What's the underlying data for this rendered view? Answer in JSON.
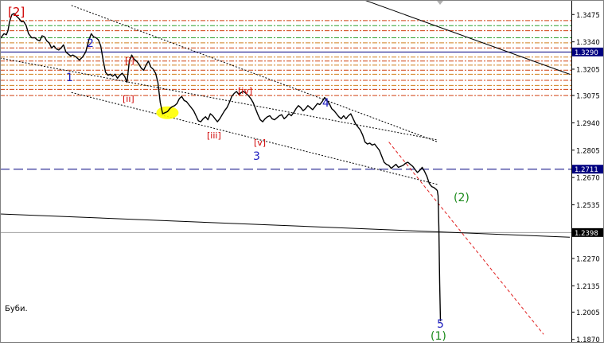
{
  "chart_data": {
    "type": "line",
    "symbol_label": "Буби.",
    "corner_label": "[2]",
    "y_axis": {
      "ticks": [
        1.3475,
        1.334,
        1.3205,
        1.3075,
        1.294,
        1.2805,
        1.267,
        1.2535,
        1.2405,
        1.227,
        1.2135,
        1.2005,
        1.187
      ],
      "range": [
        1.1865,
        1.3535
      ],
      "price_tags": [
        {
          "value": 1.329,
          "text": "1.3290",
          "style": "blue"
        },
        {
          "value": 1.2711,
          "text": "1.2711",
          "style": "blue"
        },
        {
          "value": 1.2398,
          "text": "1.2398",
          "style": "black"
        }
      ]
    },
    "wave_labels": [
      {
        "text": "[2]",
        "color": "#d00000"
      },
      {
        "text": "1",
        "color": "#2020c0"
      },
      {
        "text": "2",
        "color": "#2020c0"
      },
      {
        "text": "[i]",
        "color": "#d00000"
      },
      {
        "text": "[ii]",
        "color": "#d00000"
      },
      {
        "text": "[iii]",
        "color": "#d00000"
      },
      {
        "text": "[iv]",
        "color": "#d00000"
      },
      {
        "text": "[v]",
        "color": "#d00000"
      },
      {
        "text": "3",
        "color": "#2020c0"
      },
      {
        "text": "4",
        "color": "#2020c0"
      },
      {
        "text": "(2)",
        "color": "#1a8a1a"
      },
      {
        "text": "5",
        "color": "#2020c0"
      },
      {
        "text": "(1)",
        "color": "#1a8a1a"
      }
    ],
    "horizontal_levels": [
      {
        "value": 1.329,
        "style": "solid",
        "color": "#000080"
      },
      {
        "value": 1.2711,
        "style": "dashed",
        "color": "#000080"
      },
      {
        "value": 1.2398,
        "style": "solid",
        "color": "#a0a0a0"
      }
    ],
    "resistance_band_levels": [
      {
        "value": 1.3445,
        "color": "#d04010"
      },
      {
        "value": 1.342,
        "color": "#30a030"
      },
      {
        "value": 1.3395,
        "color": "#d04010"
      },
      {
        "value": 1.336,
        "color": "#30a030"
      },
      {
        "value": 1.3335,
        "color": "#d08020"
      },
      {
        "value": 1.331,
        "color": "#d04010"
      },
      {
        "value": 1.3265,
        "color": "#d08020"
      },
      {
        "value": 1.3245,
        "color": "#d04010"
      },
      {
        "value": 1.3225,
        "color": "#d08020"
      },
      {
        "value": 1.32,
        "color": "#d04010"
      },
      {
        "value": 1.318,
        "color": "#d08020"
      },
      {
        "value": 1.315,
        "color": "#d04010"
      },
      {
        "value": 1.3125,
        "color": "#d08020"
      },
      {
        "value": 1.3105,
        "color": "#d04010"
      },
      {
        "value": 1.3075,
        "color": "#d04010"
      }
    ],
    "price_series": {
      "name": "",
      "x": [
        0,
        2,
        5,
        8,
        10,
        12,
        15,
        18,
        20,
        24,
        27,
        30,
        33,
        36,
        40,
        44,
        47,
        50,
        53,
        56,
        59,
        62,
        65,
        68,
        71,
        74,
        77,
        80,
        83,
        86,
        89,
        92,
        96,
        100,
        104,
        108,
        112,
        115,
        118,
        121,
        124,
        127,
        130,
        133,
        136,
        139,
        142,
        145,
        148,
        151,
        154,
        157,
        160,
        163,
        166,
        169,
        172,
        175,
        178,
        181,
        184,
        187,
        190,
        193,
        196,
        199,
        202,
        205,
        208,
        211,
        214,
        217,
        220,
        223,
        226,
        229,
        232,
        235,
        238,
        241,
        244,
        247,
        250,
        253,
        256,
        259,
        262,
        265,
        268,
        271,
        274,
        277,
        280,
        283,
        286,
        289,
        292,
        295,
        298,
        301,
        304,
        307,
        310,
        313,
        316,
        319,
        322,
        325,
        328,
        331,
        334,
        337,
        340,
        343,
        346,
        349,
        352,
        355,
        358,
        361,
        364,
        367,
        370,
        373,
        376,
        379,
        382,
        385,
        388,
        391,
        394,
        397,
        400,
        403,
        406,
        409,
        412,
        415,
        418,
        421,
        424,
        427,
        430,
        433,
        436,
        439,
        442,
        445,
        448,
        451,
        454,
        457,
        460,
        463,
        466,
        469,
        472,
        475,
        478,
        481,
        484,
        487,
        490,
        493,
        496,
        499,
        502,
        505,
        508,
        511,
        514,
        517,
        520,
        523,
        526,
        529,
        532,
        535,
        538,
        541,
        544,
        547,
        550,
        551,
        552,
        553,
        554,
        555
      ],
      "y": [
        1.3355,
        1.3365,
        1.338,
        1.3375,
        1.3395,
        1.344,
        1.3475,
        1.348,
        1.347,
        1.3455,
        1.344,
        1.344,
        1.342,
        1.338,
        1.336,
        1.336,
        1.335,
        1.3345,
        1.337,
        1.3365,
        1.3345,
        1.3335,
        1.331,
        1.332,
        1.3305,
        1.33,
        1.331,
        1.3325,
        1.329,
        1.328,
        1.327,
        1.3275,
        1.3265,
        1.325,
        1.3265,
        1.329,
        1.335,
        1.338,
        1.3365,
        1.336,
        1.335,
        1.332,
        1.325,
        1.319,
        1.3175,
        1.318,
        1.317,
        1.318,
        1.316,
        1.3175,
        1.3185,
        1.317,
        1.314,
        1.3245,
        1.3275,
        1.3255,
        1.3245,
        1.323,
        1.321,
        1.32,
        1.3225,
        1.3245,
        1.3215,
        1.3205,
        1.3185,
        1.314,
        1.304,
        1.2985,
        1.299,
        1.2995,
        1.301,
        1.302,
        1.3025,
        1.3035,
        1.306,
        1.307,
        1.305,
        1.3045,
        1.303,
        1.3015,
        1.3,
        1.2975,
        1.295,
        1.2945,
        1.296,
        1.297,
        1.2955,
        1.2985,
        1.2975,
        1.296,
        1.2945,
        1.296,
        1.298,
        1.3,
        1.3015,
        1.304,
        1.307,
        1.3085,
        1.3095,
        1.308,
        1.309,
        1.3095,
        1.3085,
        1.3075,
        1.306,
        1.304,
        1.301,
        1.298,
        1.2955,
        1.2945,
        1.296,
        1.297,
        1.2975,
        1.296,
        1.2955,
        1.2965,
        1.2975,
        1.298,
        1.296,
        1.297,
        1.2985,
        1.2975,
        1.299,
        1.301,
        1.3025,
        1.3015,
        1.3,
        1.301,
        1.3025,
        1.3015,
        1.3005,
        1.302,
        1.3035,
        1.303,
        1.3045,
        1.3065,
        1.305,
        1.3035,
        1.301,
        1.3,
        1.2985,
        1.297,
        1.296,
        1.2975,
        1.296,
        1.2975,
        1.2985,
        1.296,
        1.2935,
        1.292,
        1.2905,
        1.288,
        1.2845,
        1.2835,
        1.284,
        1.283,
        1.2835,
        1.282,
        1.2805,
        1.2775,
        1.2745,
        1.2735,
        1.273,
        1.2715,
        1.2725,
        1.2735,
        1.272,
        1.2725,
        1.273,
        1.274,
        1.2745,
        1.2735,
        1.2725,
        1.271,
        1.2695,
        1.2705,
        1.272,
        1.27,
        1.2675,
        1.264,
        1.2625,
        1.262,
        1.261,
        1.2605,
        1.258,
        1.242,
        1.215,
        1.196,
        1.205,
        1.21,
        1.213
      ],
      "xlim": [
        0,
        720
      ]
    },
    "trend_lines": [
      {
        "from": [
          90,
          1.352
        ],
        "to": [
          552,
          1.2845
        ],
        "style": "dotted"
      },
      {
        "from": [
          90,
          1.309
        ],
        "to": [
          552,
          1.2635
        ],
        "style": "dotted"
      },
      {
        "from": [
          0,
          1.326
        ],
        "to": [
          552,
          1.2855
        ],
        "style": "dotted"
      },
      {
        "from": [
          372,
          1.367
        ],
        "to": [
          718,
          1.318
        ],
        "style": "solid"
      },
      {
        "from": [
          0,
          1.249
        ],
        "to": [
          718,
          1.2375
        ],
        "style": "solid"
      },
      {
        "from": [
          490,
          1.2845
        ],
        "to": [
          685,
          1.1895
        ],
        "style": "dashed-red"
      }
    ],
    "highlight": {
      "x": 211,
      "y": 1.299,
      "color": "#ffff00"
    }
  }
}
